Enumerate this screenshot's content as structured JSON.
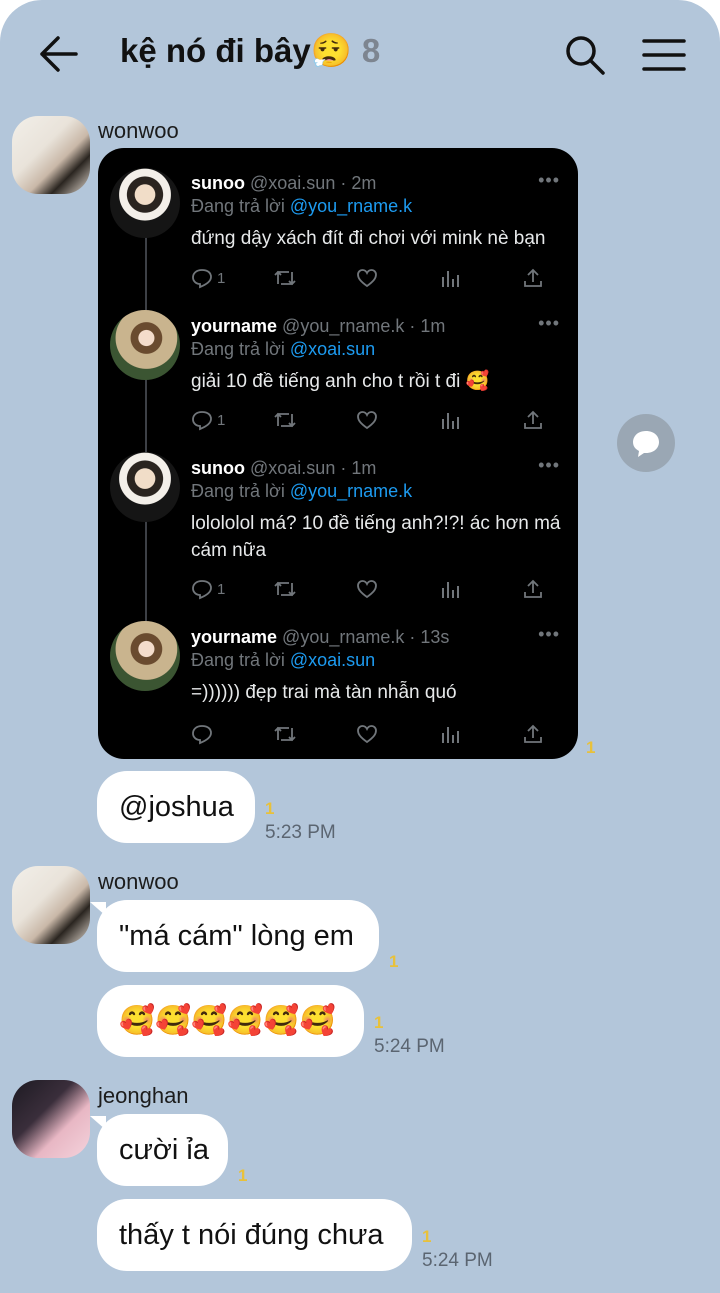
{
  "header": {
    "title": "kệ nó đi bây",
    "title_emoji": "😮‍💨",
    "member_count": "8"
  },
  "messages": {
    "m1": {
      "sender": "wonwoo",
      "unread": "1"
    },
    "m2": {
      "text": "@joshua",
      "unread": "1",
      "time": "5:23 PM"
    },
    "m3": {
      "sender": "wonwoo",
      "text": "\"má cám\" lòng em",
      "unread": "1"
    },
    "m4": {
      "text": "🥰🥰🥰🥰🥰🥰",
      "unread": "1",
      "time": "5:24 PM"
    },
    "m5": {
      "sender": "jeonghan",
      "text": "cười ỉa",
      "unread": "1"
    },
    "m6": {
      "text": "thấy t nói đúng chưa",
      "unread": "1",
      "time": "5:24 PM"
    }
  },
  "tweets": [
    {
      "name": "sunoo",
      "handle": "@xoai.sun · 2m",
      "reply_prefix": "Đang trả lời ",
      "reply_to": "@you_rname.k",
      "text": "đứng dậy xách đít đi chơi với mink nè bạn",
      "reply_count": "1",
      "more": "•••"
    },
    {
      "name": "yourname",
      "handle": "@you_rname.k · 1m",
      "reply_prefix": "Đang trả lời ",
      "reply_to": "@xoai.sun",
      "text": "giải 10 đề tiếng anh cho t rồi t đi 🥰",
      "reply_count": "1",
      "more": "•••"
    },
    {
      "name": "sunoo",
      "handle": "@xoai.sun · 1m",
      "reply_prefix": "Đang trả lời ",
      "reply_to": "@you_rname.k",
      "text": "lolololol má? 10 đề tiếng anh?!?! ác hơn má cám nữa",
      "reply_count": "1",
      "more": "•••"
    },
    {
      "name": "yourname",
      "handle": "@you_rname.k · 13s",
      "reply_prefix": "Đang trả lời ",
      "reply_to": "@xoai.sun",
      "text": "=)))))) đẹp trai mà tàn nhẫn quó",
      "reply_count": "",
      "more": "•••"
    }
  ],
  "icons": {
    "back": "back-arrow-icon",
    "search": "search-icon",
    "menu": "hamburger-menu-icon",
    "share": "share-speech-bubble-icon",
    "reply": "reply-icon",
    "retweet": "retweet-icon",
    "like": "heart-icon",
    "views": "views-icon",
    "share_tweet": "share-upload-icon"
  },
  "colors": {
    "background": "#b3c6da",
    "bubble": "#ffffff",
    "unread": "#e8c13b",
    "mention": "#1d9bf0"
  }
}
